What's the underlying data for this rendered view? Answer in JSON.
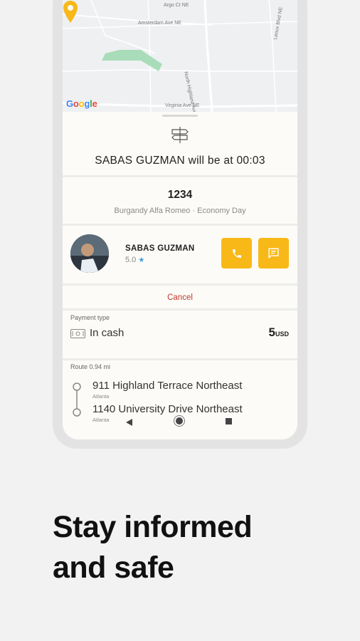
{
  "map": {
    "streets": [
      "Argo Ct NE",
      "Amsterdam Ave NE",
      "North Highland Avenue",
      "Lenox Blvd NE",
      "Virginia Ave NE"
    ],
    "logo": "Google"
  },
  "trip": {
    "eta_text": "SABAS GUZMAN will be at 00:03",
    "car_plate": "1234",
    "car_description": "Burgandy Alfa Romeo · Economy Day"
  },
  "driver": {
    "name": "SABAS GUZMAN",
    "rating": "5.0"
  },
  "actions": {
    "cancel_label": "Cancel"
  },
  "payment": {
    "label": "Payment type",
    "method": "In cash",
    "amount": "5",
    "currency": "USD"
  },
  "route": {
    "label": "Route 0.94 mi",
    "stops": [
      {
        "address": "911 Highland Terrace Northeast",
        "city": "Atlanta"
      },
      {
        "address": "1140 University Drive Northeast",
        "city": "Atlanta"
      }
    ]
  },
  "headline": {
    "line1": "Stay informed",
    "line2": "and safe"
  },
  "colors": {
    "accent": "#f8b818",
    "cancel": "#c0392b",
    "star": "#3b9ddd",
    "park": "#a9dcb8"
  }
}
